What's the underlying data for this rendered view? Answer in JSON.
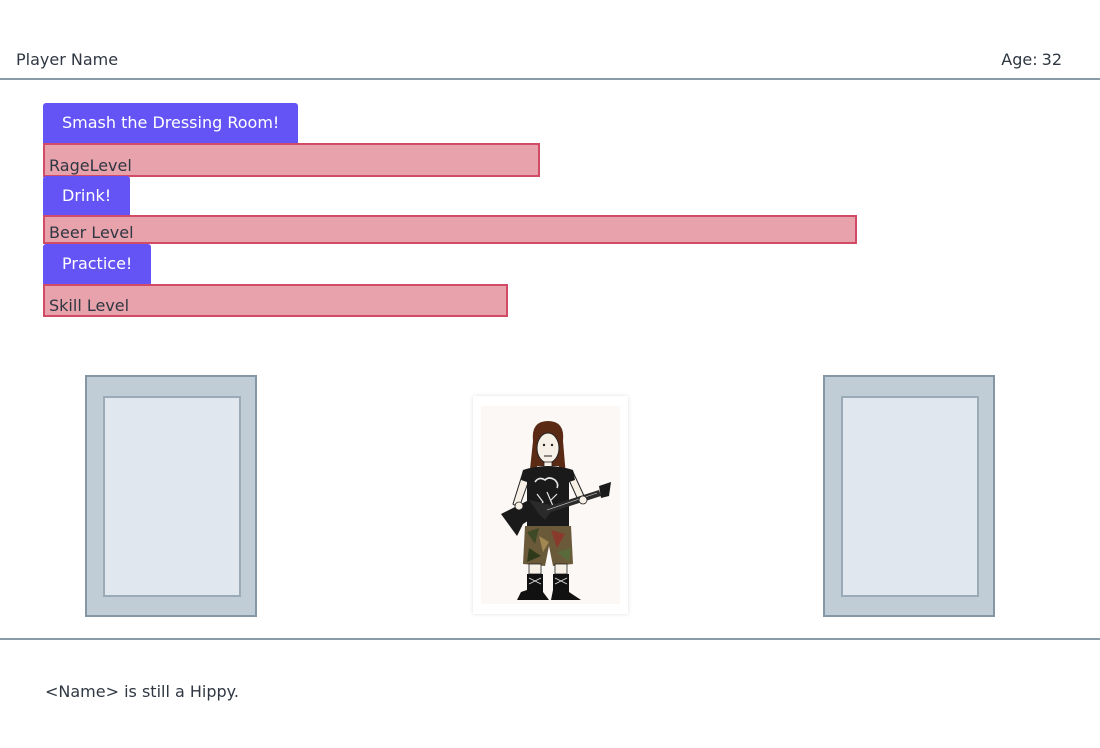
{
  "header": {
    "player_name": "Player Name",
    "age_label": "Age:",
    "age_value": "32"
  },
  "actions": [
    {
      "button_label": "Smash the Dressing Room!",
      "meter_label": "RageLevel",
      "meter_level_percent": 47
    },
    {
      "button_label": "Drink!",
      "meter_label": "Beer Level",
      "meter_level_percent": 77
    },
    {
      "button_label": "Practice!",
      "meter_label": "Skill Level",
      "meter_level_percent": 44
    }
  ],
  "scene": {
    "left_frame": "empty-frame",
    "avatar": "metal-guitarist-icon",
    "right_frame": "empty-frame"
  },
  "status_message": "<Name> is still a Hippy.",
  "colors": {
    "button": "#6554f5",
    "meter_fill": "#e8a2ab",
    "meter_border": "#d14a66",
    "frame_outer": "#c0ccd6",
    "frame_inner": "#e0e7ef",
    "rule": "#8a9ba8"
  }
}
